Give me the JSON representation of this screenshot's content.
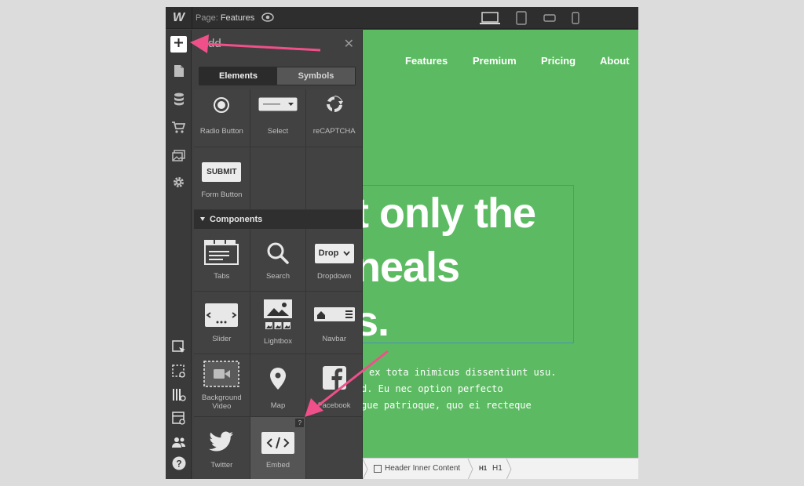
{
  "topbar": {
    "logo": "W",
    "page_prefix": "Page:",
    "page_name": "Features"
  },
  "panel": {
    "title": "Add",
    "tabs": [
      {
        "label": "Elements",
        "active": true
      },
      {
        "label": "Symbols",
        "active": false
      }
    ],
    "form_items": [
      {
        "label": "Radio Button",
        "icon": "radio-button-icon"
      },
      {
        "label": "Select",
        "icon": "select-icon"
      },
      {
        "label": "reCAPTCHA",
        "icon": "recaptcha-icon"
      }
    ],
    "form_button": {
      "label": "Form Button",
      "button_text": "SUBMIT"
    },
    "components_title": "Components",
    "components": [
      {
        "label": "Tabs",
        "icon": "tabs-icon"
      },
      {
        "label": "Search",
        "icon": "search-icon"
      },
      {
        "label": "Dropdown",
        "icon": "dropdown-icon",
        "chip_text": "Drop"
      },
      {
        "label": "Slider",
        "icon": "slider-icon"
      },
      {
        "label": "Lightbox",
        "icon": "lightbox-icon"
      },
      {
        "label": "Navbar",
        "icon": "navbar-icon"
      },
      {
        "label": "Background Video",
        "icon": "background-video-icon"
      },
      {
        "label": "Map",
        "icon": "map-pin-icon"
      },
      {
        "label": "Facebook",
        "icon": "facebook-icon"
      },
      {
        "label": "Twitter",
        "icon": "twitter-icon"
      },
      {
        "label": "Embed",
        "icon": "embed-icon",
        "help": "?"
      }
    ]
  },
  "canvas": {
    "nav": [
      "Features",
      "Premium",
      "Pricing",
      "About"
    ],
    "hero_lines": [
      "t only the",
      "neals",
      "s."
    ],
    "body_lines": [
      "ex tota inimicus dissentiunt usu.",
      "d. Eu nec option perfecto",
      "gue patrioque, quo ei recteque"
    ],
    "accent_color": "#5cbb62"
  },
  "breadcrumb": {
    "items": [
      "Header Inner Content",
      "H1"
    ],
    "h1_tag": "H1"
  },
  "annotations": {
    "arrow_color": "#f0508a"
  }
}
